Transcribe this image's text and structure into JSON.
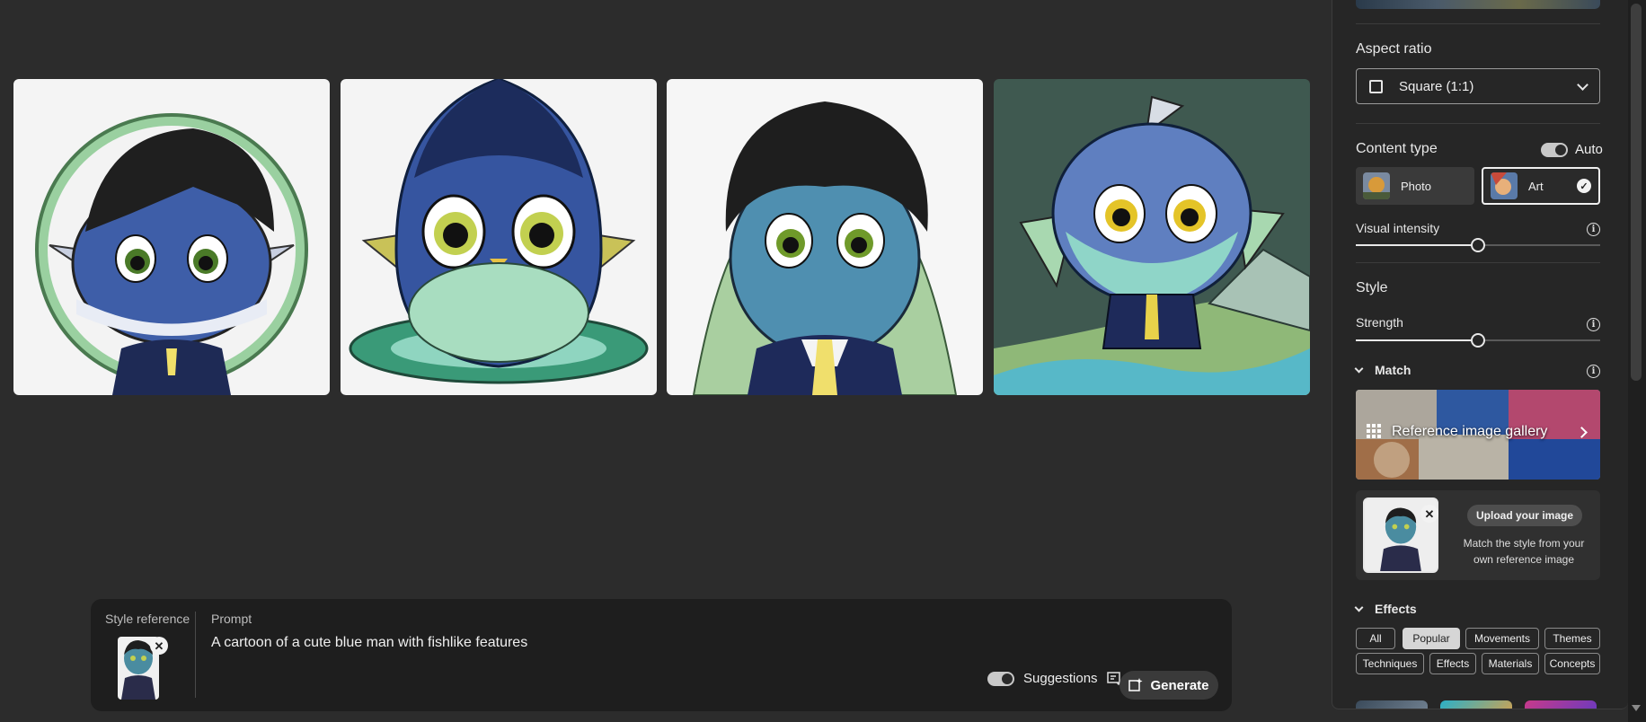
{
  "prompt_bar": {
    "style_reference_label": "Style reference",
    "prompt_label": "Prompt",
    "prompt_text": "A cartoon of a cute blue man with fishlike features",
    "suggestions_label": "Suggestions",
    "generate_label": "Generate",
    "remove_symbol": "✕"
  },
  "panel": {
    "aspect_ratio": {
      "title": "Aspect ratio",
      "value": "Square (1:1)"
    },
    "content_type": {
      "title": "Content type",
      "auto_label": "Auto",
      "options": [
        {
          "label": "Photo",
          "selected": false
        },
        {
          "label": "Art",
          "selected": true
        }
      ],
      "check_symbol": "✓"
    },
    "visual_intensity": {
      "label": "Visual intensity",
      "value": 0.5
    },
    "style": {
      "title": "Style",
      "strength_label": "Strength",
      "strength_value": 0.5
    },
    "match": {
      "title": "Match",
      "gallery_label": "Reference image gallery",
      "upload_button": "Upload your image",
      "upload_description": "Match the style from your own reference image",
      "remove_symbol": "✕"
    },
    "effects": {
      "title": "Effects",
      "chips": [
        "All",
        "Popular",
        "Movements",
        "Themes",
        "Techniques",
        "Effects",
        "Materials",
        "Concepts"
      ],
      "active_chip": "Popular"
    },
    "info_symbol": "i"
  },
  "colors": {
    "background": "#2c2c2c",
    "panel": "#262626",
    "prompt_bar": "#1e1e1e",
    "accent_light": "#e8e8e8"
  }
}
